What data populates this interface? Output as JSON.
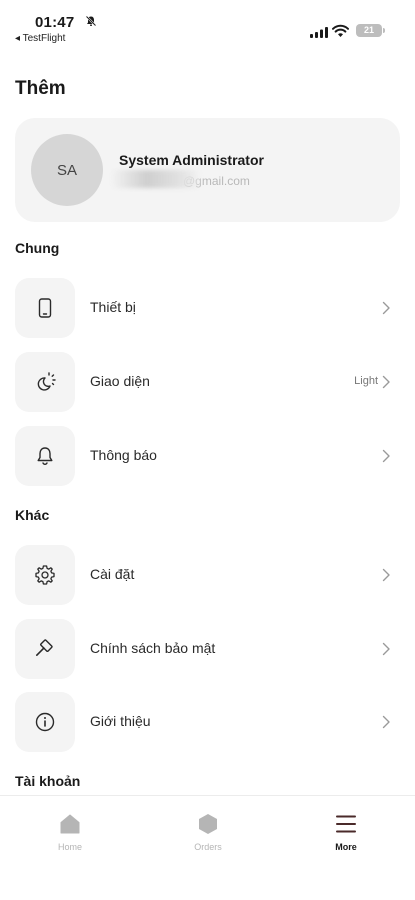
{
  "status_bar": {
    "time": "01:47",
    "back_app": "◂ TestFlight",
    "battery": "21"
  },
  "header": {
    "title": "Thêm"
  },
  "profile": {
    "initials": "SA",
    "name": "System Administrator",
    "email_visible": "@gmail.com"
  },
  "sections": {
    "general": "Chung",
    "other": "Khác",
    "account": "Tài khoản"
  },
  "menu": {
    "device": {
      "label": "Thiết bị",
      "icon": "phone-icon"
    },
    "appearance": {
      "label": "Giao diện",
      "value": "Light",
      "icon": "theme-icon"
    },
    "notifications": {
      "label": "Thông báo",
      "icon": "bell-icon"
    },
    "settings": {
      "label": "Cài đặt",
      "icon": "gear-icon"
    },
    "privacy": {
      "label": "Chính sách bảo mật",
      "icon": "gavel-icon"
    },
    "about": {
      "label": "Giới thiệu",
      "icon": "info-icon"
    }
  },
  "bottom_nav": {
    "home": "Home",
    "orders": "Orders",
    "more": "More",
    "active": "More"
  },
  "colors": {
    "card_bg": "#f4f4f4",
    "inactive_nav": "#b5b5b5",
    "more_icon": "#4a2a2a"
  }
}
